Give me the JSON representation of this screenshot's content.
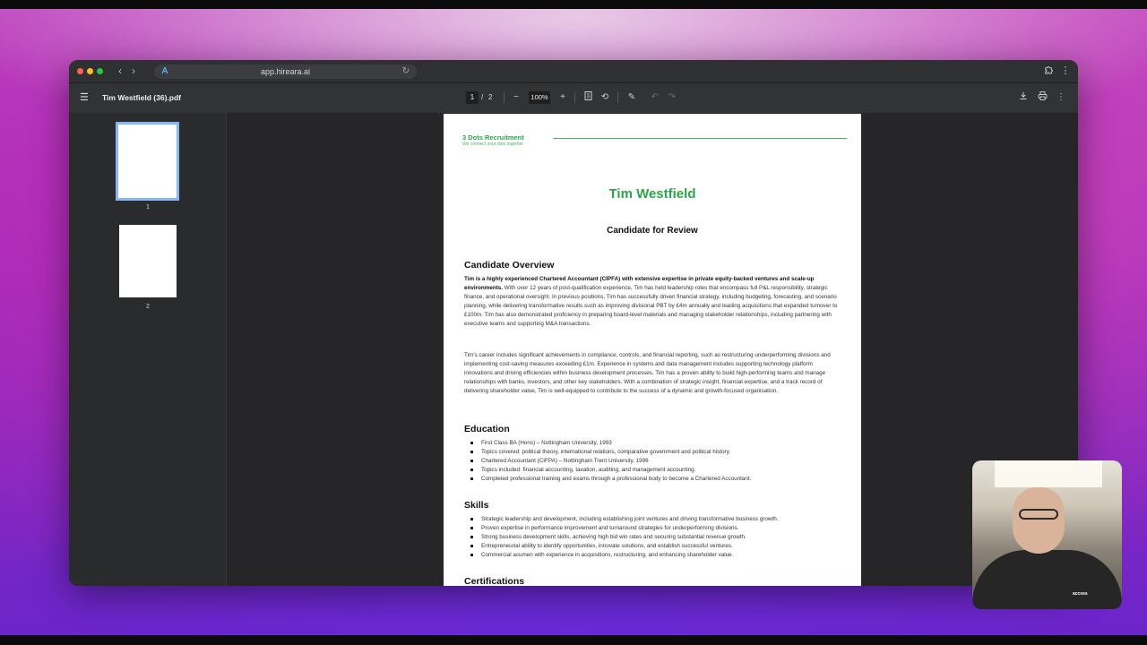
{
  "browser": {
    "url": "app.hireara.ai"
  },
  "pdf_toolbar": {
    "filename": "Tim Westfield (36).pdf",
    "current_page": "1",
    "page_separator": "/",
    "total_pages": "2",
    "zoom": "100%"
  },
  "thumbnails": [
    {
      "label": "1",
      "selected": true
    },
    {
      "label": "2",
      "selected": false
    }
  ],
  "document": {
    "brand_name": "3 Dots Recruitment",
    "brand_tagline": "We connect your dots together",
    "candidate_name": "Tim Westfield",
    "subtitle": "Candidate for Review",
    "overview_heading": "Candidate Overview",
    "overview_bold": "Tim is a highly experienced Chartered Accountant (CIPFA) with extensive expertise in private equity-backed ventures and scale-up environments.",
    "overview_rest": " With over 12 years of post-qualification experience, Tim has held leadership roles that encompass full P&L responsibility, strategic finance, and operational oversight. In previous positions, Tim has successfully driven financial strategy, including budgeting, forecasting, and scenario planning, while delivering transformative results such as improving divisional PBT by £4m annually and leading acquisitions that expanded turnover to £100m. Tim has also demonstrated proficiency in preparing board-level materials and managing stakeholder relationships, including partnering with executive teams and supporting M&A transactions.",
    "overview_para2": "Tim's career includes significant achievements in compliance, controls, and financial reporting, such as restructuring underperforming divisions and implementing cost-saving measures exceeding £1m. Experience in systems and data management includes supporting technology platform innovations and driving efficiencies within business development processes. Tim has a proven ability to build high-performing teams and manage relationships with banks, investors, and other key stakeholders. With a combination of strategic insight, financial expertise, and a track record of delivering shareholder value, Tim is well-equipped to contribute to the success of a dynamic and growth-focused organisation.",
    "education_heading": "Education",
    "education_items": [
      "First Class BA (Hons) – Nottingham University, 1993",
      "Topics covered: political theory, international relations, comparative government and political history.",
      "Chartered Accountant (CIFPA) – Nottingham Trent University, 1996",
      "Topics included: financial accounting, taxation, auditing, and management accounting.",
      "Completed professional training and exams through a professional body to become a Chartered Accountant."
    ],
    "skills_heading": "Skills",
    "skills_items": [
      "Strategic leadership and development, including establishing joint ventures and driving transformative business growth.",
      "Proven expertise in performance improvement and turnaround strategies for underperforming divisions.",
      "Strong business development skills, achieving high bid win rates and securing substantial revenue growth.",
      "Entrepreneurial ability to identify opportunities, innovate solutions, and establish successful ventures.",
      "Commercial acumen with experience in acquisitions, restructuring, and enhancing shareholder value."
    ],
    "certifications_heading": "Certifications"
  },
  "webcam": {
    "badge": "access"
  },
  "icons": {
    "menu": "hamburger-icon",
    "download": "download-icon",
    "print": "print-icon",
    "more": "more-vert-icon",
    "extensions": "puzzle-icon"
  },
  "colors": {
    "brand_green": "#2aa54a",
    "thumbnail_selected": "#8ab4f8"
  }
}
